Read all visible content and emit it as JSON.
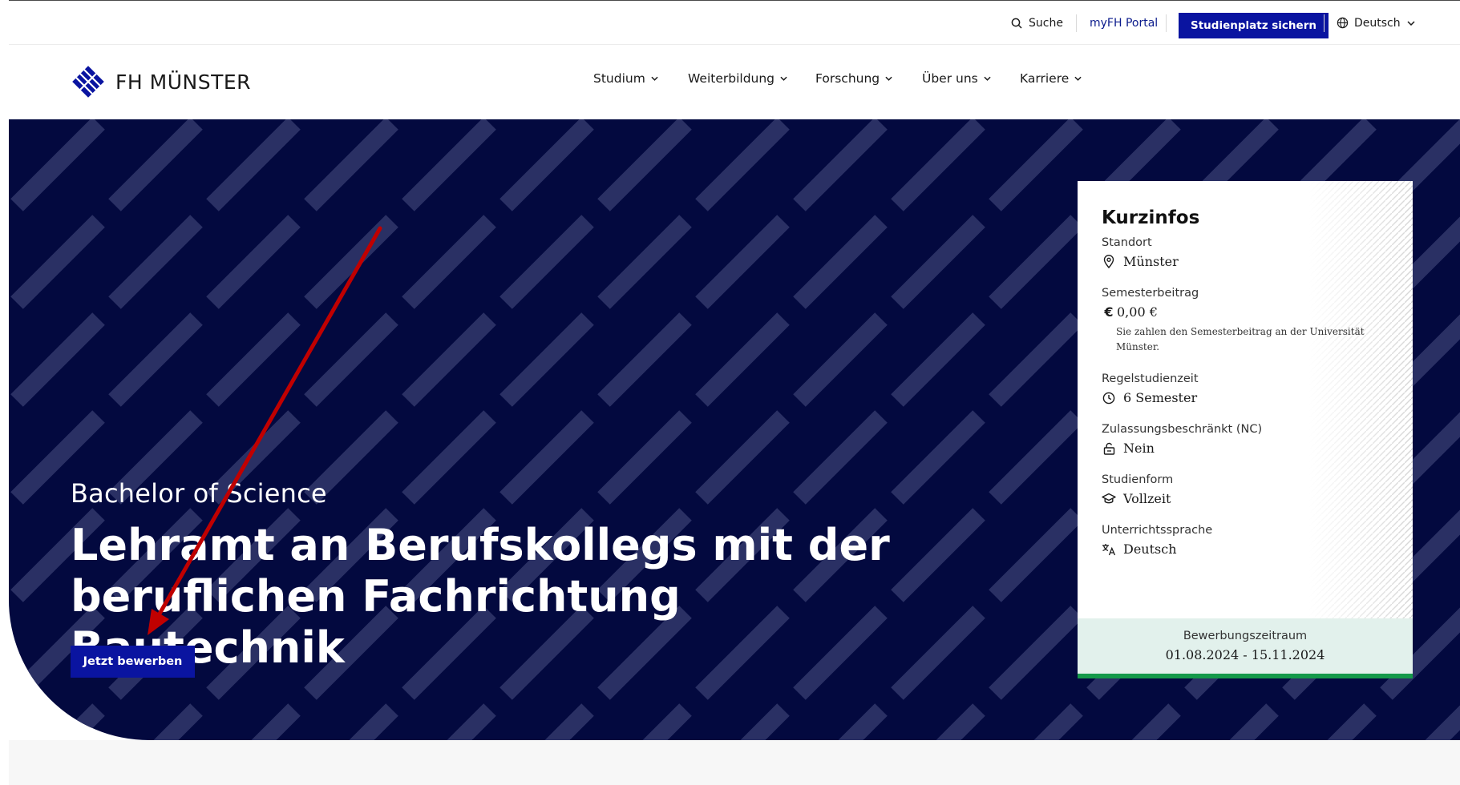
{
  "utility_bar": {
    "search_label": "Suche",
    "portal_label": "myFH Portal",
    "cta_label": "Studienplatz sichern",
    "language_label": "Deutsch"
  },
  "brand": {
    "logo_text": "FH MÜNSTER",
    "primary_color": "#0a14a0",
    "hero_color": "#03093f"
  },
  "main_nav": {
    "items": [
      {
        "label": "Studium"
      },
      {
        "label": "Weiterbildung"
      },
      {
        "label": "Forschung"
      },
      {
        "label": "Über uns"
      },
      {
        "label": "Karriere"
      }
    ]
  },
  "hero": {
    "subtitle": "Bachelor of Science",
    "title": "Lehramt an Berufskollegs mit der beruflichen Fachrichtung Bautechnik",
    "cta_label": "Jetzt bewerben"
  },
  "info_card": {
    "title": "Kurzinfos",
    "items": [
      {
        "label": "Standort",
        "value": "Münster",
        "icon": "location-pin-icon"
      },
      {
        "label": "Semesterbeitrag",
        "value": "0,00 €",
        "icon": "euro-icon",
        "note": "Sie zahlen den Semesterbeitrag an der Universität Münster."
      },
      {
        "label": "Regelstudienzeit",
        "value": "6 Semester",
        "icon": "clock-icon"
      },
      {
        "label": "Zulassungsbeschränkt (NC)",
        "value": "Nein",
        "icon": "unlock-icon"
      },
      {
        "label": "Studienform",
        "value": "Vollzeit",
        "icon": "graduation-cap-icon"
      },
      {
        "label": "Unterrichtssprache",
        "value": "Deutsch",
        "icon": "translate-icon"
      }
    ],
    "footer_label": "Bewerbungszeitraum",
    "footer_value": "01.08.2024 - 15.11.2024",
    "footer_accent": "#149a4a"
  },
  "annotation": {
    "arrow_color": "#c00000"
  }
}
